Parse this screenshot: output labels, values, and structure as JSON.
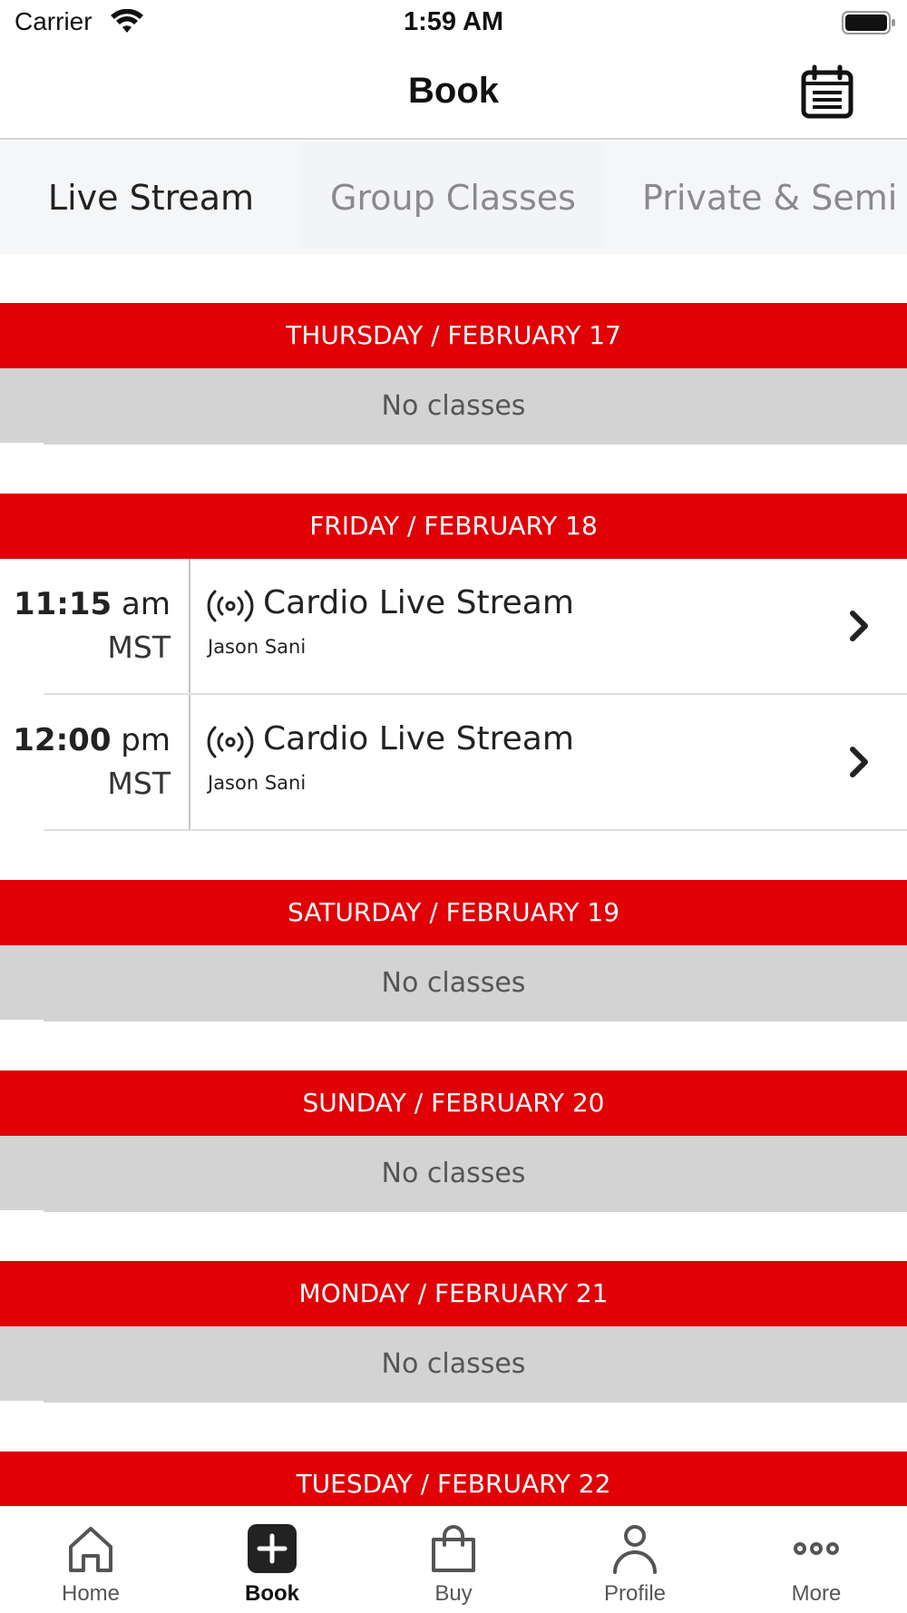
{
  "status_bar": {
    "carrier": "Carrier",
    "time": "1:59 AM"
  },
  "nav": {
    "title": "Book",
    "calendar_icon": "calendar-icon"
  },
  "tabs": [
    {
      "label": "Live Stream",
      "active": true
    },
    {
      "label": "Group Classes",
      "active": false
    },
    {
      "label": "Private & Semi P",
      "active": false
    }
  ],
  "days": [
    {
      "header": "THURSDAY / FEBRUARY 17",
      "empty_text": "No classes"
    },
    {
      "header": "FRIDAY / FEBRUARY 18",
      "classes": [
        {
          "time": "11:15",
          "ampm": "am",
          "tz": "MST",
          "name": "Cardio Live Stream",
          "instructor": "Jason Sani"
        },
        {
          "time": "12:00",
          "ampm": "pm",
          "tz": "MST",
          "name": "Cardio Live Stream",
          "instructor": "Jason Sani"
        }
      ]
    },
    {
      "header": "SATURDAY / FEBRUARY 19",
      "empty_text": "No classes"
    },
    {
      "header": "SUNDAY / FEBRUARY 20",
      "empty_text": "No classes"
    },
    {
      "header": "MONDAY / FEBRUARY 21",
      "empty_text": "No classes"
    },
    {
      "header": "TUESDAY / FEBRUARY 22"
    }
  ],
  "tab_bar": [
    {
      "label": "Home",
      "icon": "home-icon",
      "active": false
    },
    {
      "label": "Book",
      "icon": "plus-square-icon",
      "active": true
    },
    {
      "label": "Buy",
      "icon": "shopping-bag-icon",
      "active": false
    },
    {
      "label": "Profile",
      "icon": "person-icon",
      "active": false
    },
    {
      "label": "More",
      "icon": "more-dots-icon",
      "active": false
    }
  ],
  "colors": {
    "accent": "#e00006",
    "empty_bg": "#d3d3d3",
    "tabs_bg": "#f5f6f8"
  }
}
